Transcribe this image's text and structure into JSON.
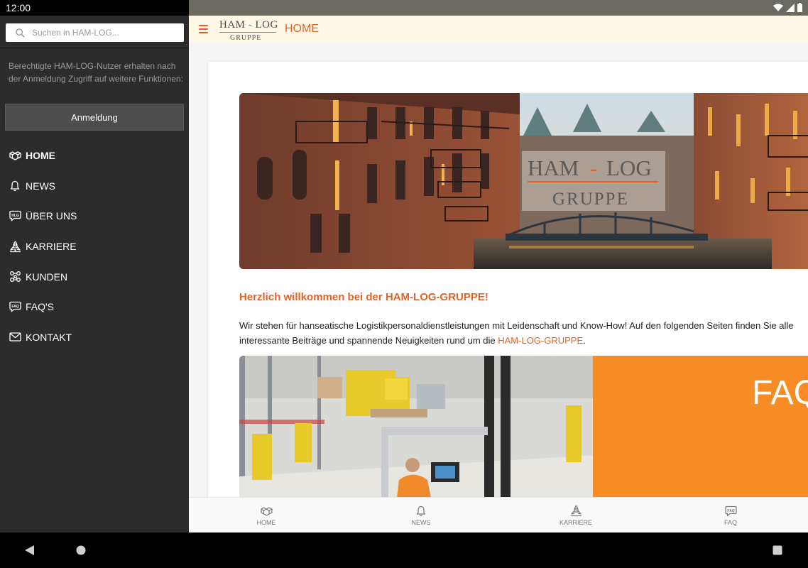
{
  "status_bar": {
    "time": "12:00"
  },
  "drawer": {
    "search": {
      "placeholder": "Suchen in HAM-LOG..."
    },
    "info_text": "Berechtigte HAM-LOG-Nutzer erhalten nach der Anmeldung Zugriff auf weitere Funktionen:",
    "login_label": "Anmeldung",
    "items": [
      {
        "label": "HOME",
        "icon": "home-boxes-icon",
        "active": true
      },
      {
        "label": "NEWS",
        "icon": "bell-icon",
        "active": false
      },
      {
        "label": "ÜBER UNS",
        "icon": "hlg-chat-icon",
        "active": false
      },
      {
        "label": "KARRIERE",
        "icon": "rocket-icon",
        "active": false
      },
      {
        "label": "KUNDEN",
        "icon": "network-icon",
        "active": false
      },
      {
        "label": "FAQ'S",
        "icon": "faq-icon",
        "active": false
      },
      {
        "label": "KONTAKT",
        "icon": "mail-icon",
        "active": false
      }
    ]
  },
  "appbar": {
    "logo_line1_left": "HAM",
    "logo_line1_dash": "-",
    "logo_line1_right": "LOG",
    "logo_line2": "GRUPPE",
    "title": "HOME"
  },
  "content": {
    "hero_logo_line1_left": "HAM",
    "hero_logo_line1_dash": "-",
    "hero_logo_line1_right": "LOG",
    "hero_logo_line2": "GRUPPE",
    "welcome_title": "Herzlich willkommen bei der HAM-LOG-GRUPPE!",
    "welcome_line1": "Wir stehen für hanseatische Logistikpersonaldienstleistungen mit Leidenschaft und Know-How! Auf den folgenden Seiten finden Sie alle",
    "welcome_line2_pre": "interessante Beiträge und spannende Neuigkeiten rund um die ",
    "welcome_link": "HAM-LOG-GRUPPE",
    "welcome_line2_post": ".",
    "faq_banner_text": "FAQ"
  },
  "bottom_nav": [
    {
      "label": "HOME",
      "icon": "home-boxes-icon"
    },
    {
      "label": "NEWS",
      "icon": "bell-icon"
    },
    {
      "label": "KARRIERE",
      "icon": "rocket-icon"
    },
    {
      "label": "FAQ",
      "icon": "faq-icon"
    }
  ],
  "colors": {
    "accent": "#e2632a",
    "drawer_bg": "#2c2c2c",
    "appbar_bg": "#fff8e7",
    "faq_orange": "#f68c23"
  }
}
